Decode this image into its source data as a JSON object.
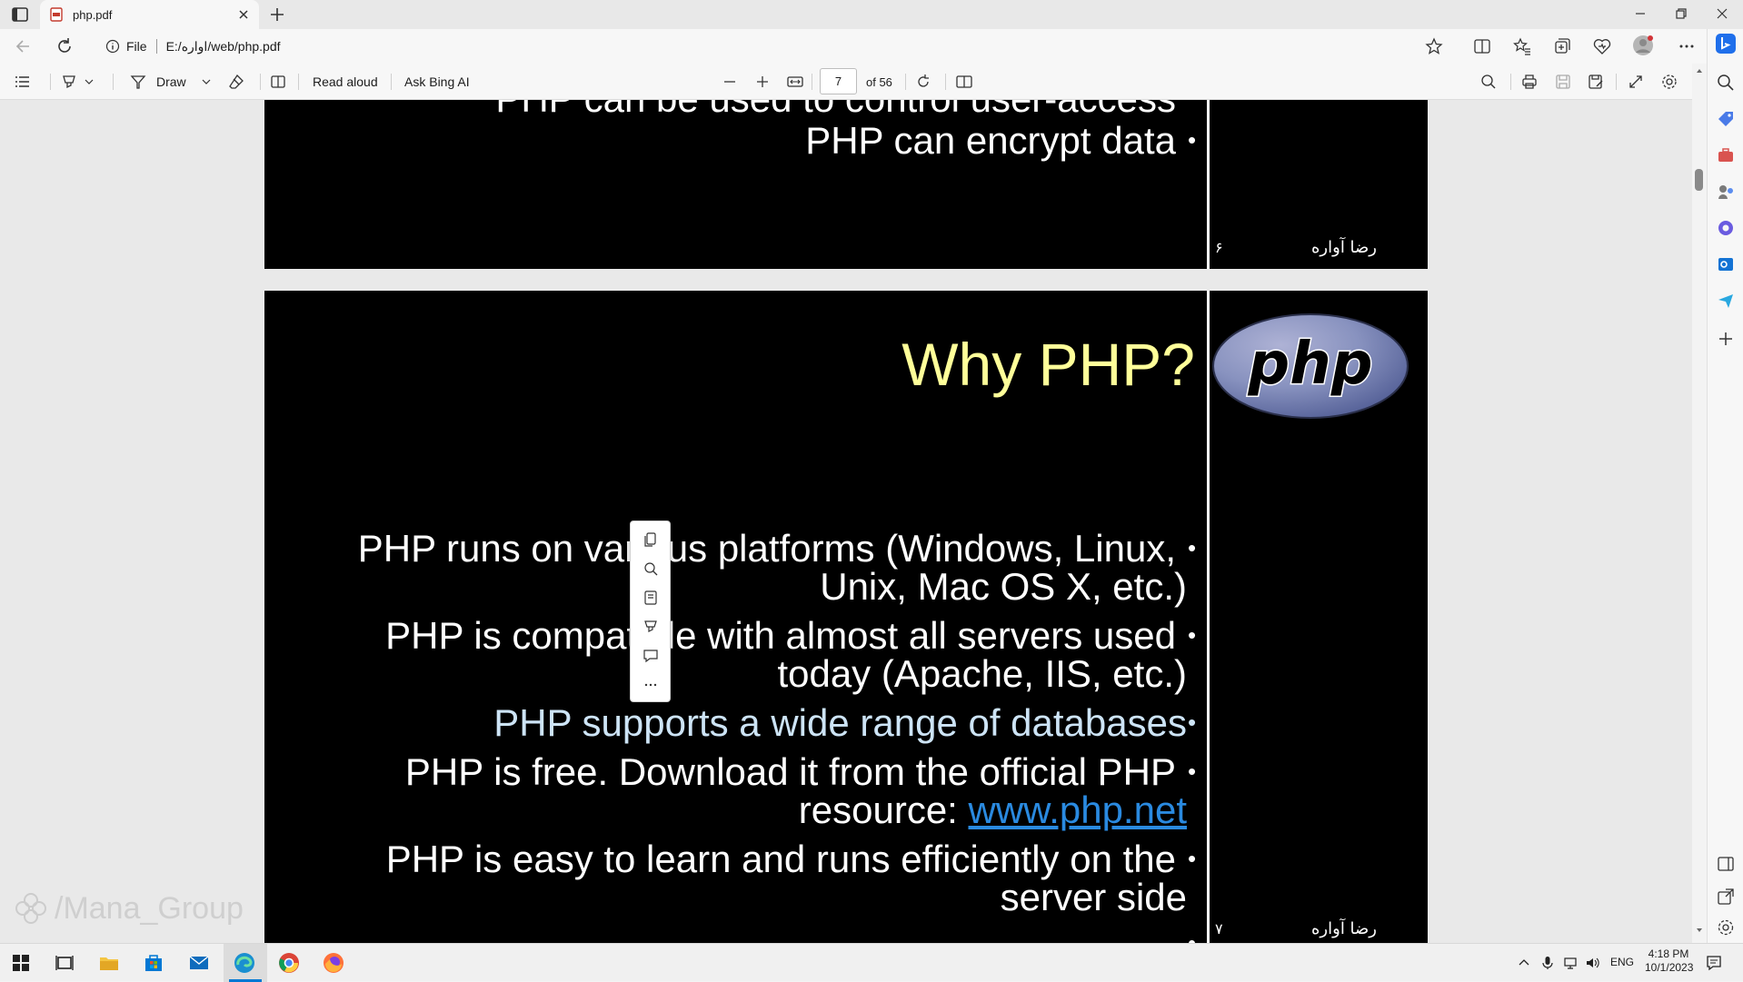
{
  "browser": {
    "tab_title": "php.pdf",
    "address_prefix": "File",
    "address_url": "E:/اواره/web/php.pdf"
  },
  "pdf_toolbar": {
    "draw_label": "Draw",
    "read_aloud_label": "Read aloud",
    "ask_bing_label": "Ask Bing AI",
    "current_page": "7",
    "page_total": "of 56"
  },
  "slides": [
    {
      "partial_line": "PHP can be used to control user-access",
      "bullets": [
        "PHP can encrypt data"
      ],
      "footer_author": "رضا آواره",
      "footer_page": "۶"
    },
    {
      "title": "Why PHP?",
      "logo_text": "php",
      "bullets": [
        {
          "line1": "PHP runs on various platforms (Windows, Linux,",
          "line2": "Unix, Mac OS X, etc.)"
        },
        {
          "line1": "PHP is compatible with almost all servers used",
          "line2": "today (Apache, IIS, etc.)"
        },
        {
          "line1": "PHP supports a wide range of databases",
          "line2": ""
        },
        {
          "line1": "PHP is free. Download it from the official PHP",
          "line2_prefix": "resource: ",
          "link": "www.php.net"
        },
        {
          "line1": "PHP is easy to learn and runs efficiently on the",
          "line2": "server side"
        }
      ],
      "footer_author": "رضا آواره",
      "footer_page": "۷"
    }
  ],
  "watermark": "/Mana_Group",
  "taskbar": {
    "language": "ENG",
    "time": "4:18 PM",
    "date": "10/1/2023"
  },
  "colors": {
    "slide_bg": "#000000",
    "slide_text": "#ffffff",
    "title_color": "#ffff99",
    "link_color": "#2a8ae0",
    "highlight_text": "#cde4f6",
    "logo_fill": "#8892bf"
  }
}
